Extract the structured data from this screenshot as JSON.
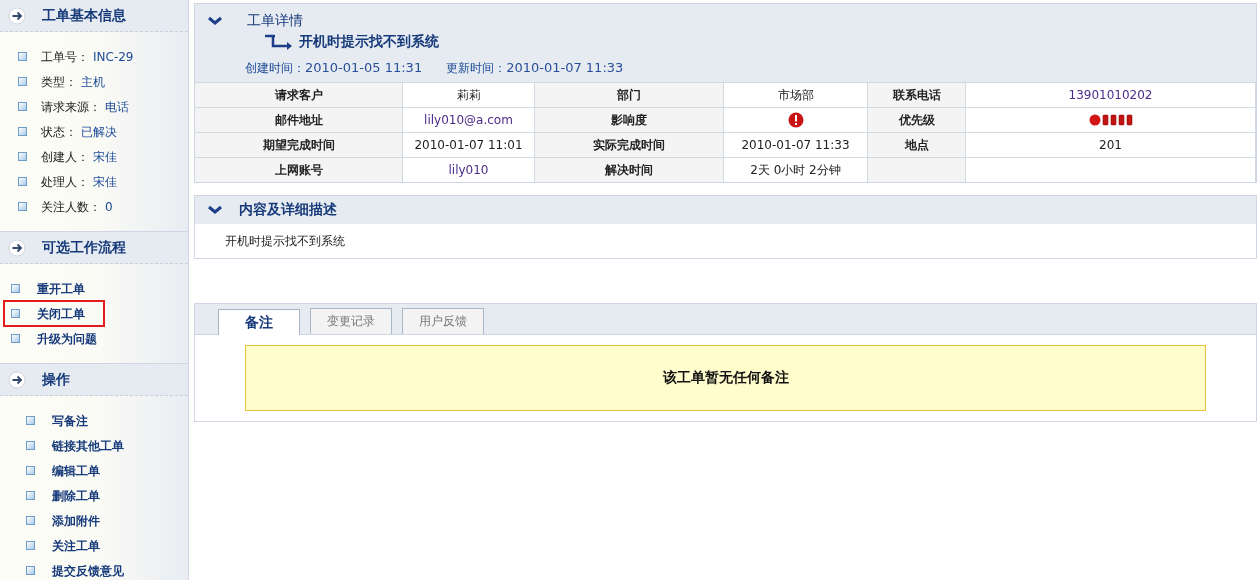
{
  "sidebar": {
    "sections": [
      {
        "title": "工单基本信息",
        "kind": "info",
        "items": [
          {
            "label": "工单号：",
            "value": "INC-29"
          },
          {
            "label": "类型：",
            "value": "主机"
          },
          {
            "label": "请求来源：",
            "value": "电话"
          },
          {
            "label": "状态：",
            "value": "已解决"
          },
          {
            "label": "创建人：",
            "value": "宋佳"
          },
          {
            "label": "处理人：",
            "value": "宋佳"
          },
          {
            "label": "关注人数：",
            "value": "0"
          }
        ]
      },
      {
        "title": "可选工作流程",
        "kind": "links",
        "items": [
          {
            "label": "重开工单",
            "highlighted": false
          },
          {
            "label": "关闭工单",
            "highlighted": true
          },
          {
            "label": "升级为问题",
            "highlighted": false
          }
        ]
      },
      {
        "title": "操作",
        "kind": "links",
        "items": [
          {
            "label": "写备注",
            "highlighted": false
          },
          {
            "label": "链接其他工单",
            "highlighted": false
          },
          {
            "label": "编辑工单",
            "highlighted": false
          },
          {
            "label": "删除工单",
            "highlighted": false
          },
          {
            "label": "添加附件",
            "highlighted": false
          },
          {
            "label": "关注工单",
            "highlighted": false
          },
          {
            "label": "提交反馈意见",
            "highlighted": false
          }
        ]
      }
    ]
  },
  "detail": {
    "title": "工单详情",
    "subject": "开机时提示找不到系统",
    "created_label": "创建时间：",
    "created": "2010-01-05 11:31",
    "updated_label": "更新时间：",
    "updated": "2010-01-07 11:33",
    "rows": [
      [
        {
          "label": "请求客户",
          "kind": "text",
          "value": "莉莉"
        },
        {
          "label": "部门",
          "kind": "text",
          "value": "市场部"
        },
        {
          "label": "联系电话",
          "kind": "link",
          "value": "13901010202"
        }
      ],
      [
        {
          "label": "邮件地址",
          "kind": "link",
          "value": "lily010@a.com"
        },
        {
          "label": "影响度",
          "kind": "impact"
        },
        {
          "label": "优先级",
          "kind": "priority"
        }
      ],
      [
        {
          "label": "期望完成时间",
          "kind": "text",
          "value": "2010-01-07 11:01"
        },
        {
          "label": "实际完成时间",
          "kind": "text",
          "value": "2010-01-07 11:33"
        },
        {
          "label": "地点",
          "kind": "text",
          "value": "201"
        }
      ],
      [
        {
          "label": "上网账号",
          "kind": "link",
          "value": "lily010"
        },
        {
          "label": "解决时间",
          "kind": "text",
          "value": "2天  0小时  2分钟"
        },
        {
          "kind": "blank"
        }
      ]
    ]
  },
  "description": {
    "title": "内容及详细描述",
    "text": "开机时提示找不到系统"
  },
  "notes": {
    "tabs": [
      {
        "label": "备注",
        "selected": true
      },
      {
        "label": "变更记录",
        "selected": false
      },
      {
        "label": "用户反馈",
        "selected": false
      }
    ],
    "message": "该工单暂无任何备注"
  }
}
